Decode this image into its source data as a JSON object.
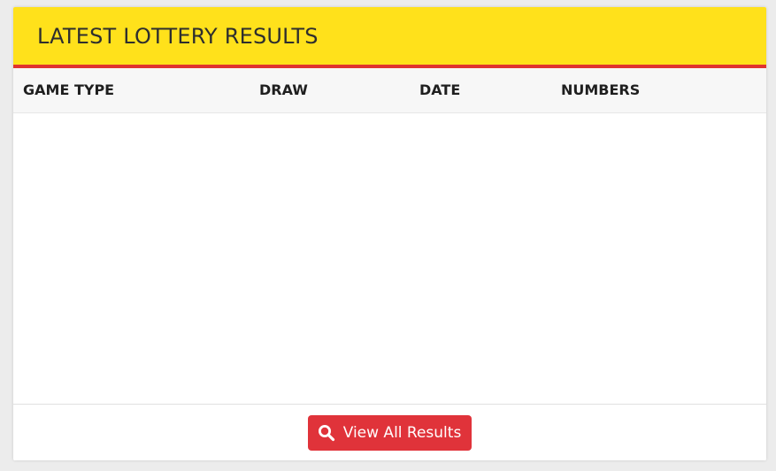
{
  "widget": {
    "title": "LATEST LOTTERY RESULTS",
    "columns": [
      "GAME TYPE",
      "DRAW",
      "DATE",
      "NUMBERS"
    ],
    "rows": [],
    "view_all_label": "View All Results",
    "view_all_icon": "search-icon"
  },
  "colors": {
    "header_bg": "#ffe11b",
    "header_accent": "#e0332f",
    "button_bg": "#e0333a"
  }
}
